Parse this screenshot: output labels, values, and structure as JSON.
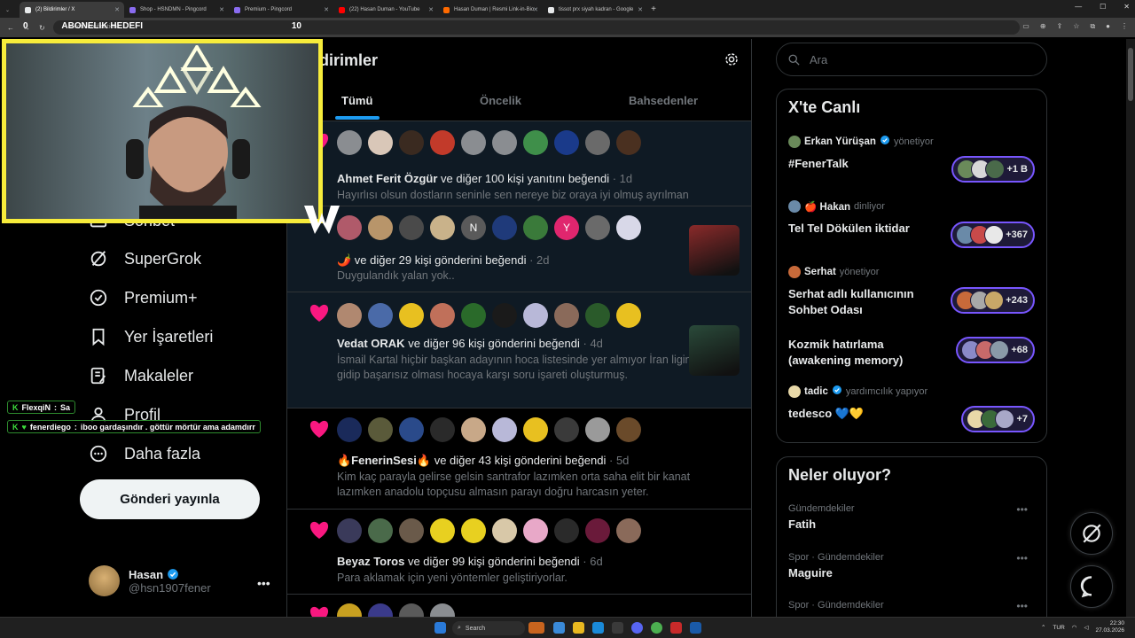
{
  "browser": {
    "tabs": [
      {
        "label": "(2) Bildirimler / X",
        "active": true,
        "color": "#e7e9ea"
      },
      {
        "label": "Shop - HSNDMN - Pingcord",
        "active": false,
        "color": "#8a6cf0"
      },
      {
        "label": "Premium - Pingcord",
        "active": false,
        "color": "#8a6cf0"
      },
      {
        "label": "(22) Hasan Duman - YouTube",
        "active": false,
        "color": "#ff0000"
      },
      {
        "label": "Hasan Duman | Resmi Link-in-Bio",
        "active": false,
        "color": "#ff6a00"
      },
      {
        "label": "tissot prx siyah kadran - Google",
        "active": false,
        "color": "#e7e9ea"
      }
    ],
    "url": "x.com/notifications"
  },
  "stream": {
    "goal_label": "ABONELIK HEDEFI",
    "goal_left": "0",
    "goal_right": "10"
  },
  "chat": [
    {
      "user": "FlexqiN",
      "message": "Sa"
    },
    {
      "user": "fenerdiego",
      "message": "iboo gardaşındır . göttür mörtür ama adamdırr"
    }
  ],
  "nav": {
    "items": [
      {
        "label": "Sohbet",
        "icon": "mail-icon"
      },
      {
        "label": "SuperGrok",
        "icon": "grok-icon"
      },
      {
        "label": "Premium+",
        "icon": "verified-icon"
      },
      {
        "label": "Yer İşaretleri",
        "icon": "bookmark-icon"
      },
      {
        "label": "Makaleler",
        "icon": "article-icon"
      },
      {
        "label": "Profil",
        "icon": "person-icon"
      },
      {
        "label": "Daha fazla",
        "icon": "more-circle-icon"
      }
    ],
    "post_button": "Gönderi yayınla",
    "profile_name": "Hasan",
    "profile_handle": "@hsn1907fener"
  },
  "main": {
    "title": "dirimler",
    "tabs": [
      "Tümü",
      "Öncelik",
      "Bahsedenler"
    ],
    "active_tab": "Tümü"
  },
  "notifications": [
    {
      "name": "Ahmet Ferit Özgür",
      "action": " ve diğer 100 kişi yanıtını beğendi",
      "time": " · 1d",
      "text": "Hayırlısı olsun dostların seninle sen nereye biz oraya iyi olmuş ayrılman",
      "avatars": [
        "#8a8d91",
        "#d9c7b8",
        "#3a2a20",
        "#c23a2a",
        "#8a8d91",
        "#8a8d91",
        "#3f8f4a",
        "#1a3a8a",
        "#6a6a6a",
        "#4a3020"
      ],
      "highlight": true
    },
    {
      "name": "🌶️",
      "action": " ve diğer 29 kişi gönderini beğendi",
      "time": " · 2d",
      "text": "Duygulandık yalan yok..",
      "avatars": [
        "#b05a6a",
        "#b8956a",
        "#4a4a4a",
        "#c9b28a",
        "#5a5a5a",
        "#1f3a7a",
        "#3a7a3a",
        "#e0266e",
        "#6a6a6a",
        "#d8d8e8"
      ],
      "letters": {
        "4": "N",
        "7": "Y"
      },
      "thumb": "#8a2a2a",
      "highlight": true
    },
    {
      "name": "Vedat ORAK",
      "action": " ve diğer 96 kişi gönderini beğendi",
      "time": " · 4d",
      "text": "İsmail Kartal hiçbir başkan adayının hoca listesinde yer almıyor İran ligine gidip başarısız olması hocaya karşı soru işareti oluşturmuş.",
      "avatars": [
        "#b08870",
        "#4a6aa8",
        "#e8c020",
        "#c0705a",
        "#2a6a2a",
        "#1a1a1a",
        "#b8b8d8",
        "#8a6a5a",
        "#2a5a2a",
        "#e8c020"
      ],
      "thumb": "#2a4a3a",
      "highlight": true
    },
    {
      "name": "🔥FenerinSesi🔥",
      "action": " ve diğer 43 kişi gönderini beğendi",
      "time": " · 5d",
      "text": "Kim kaç parayla gelirse gelsin santrafor lazımken orta saha elit bir kanat lazımken anadolu topçusu almasın parayı doğru harcasın yeter.",
      "avatars": [
        "#1a2a5a",
        "#5a5a3a",
        "#2a4a8a",
        "#2a2a2a",
        "#c8a888",
        "#b8b8d8",
        "#e8c020",
        "#3a3a3a",
        "#9a9a9a",
        "#6a4a2a"
      ],
      "highlight": false
    },
    {
      "name": "Beyaz Toros",
      "action": " ve diğer 99 kişi gönderini beğendi",
      "time": " · 6d",
      "text": "Para aklamak için yeni yöntemler geliştiriyorlar.",
      "avatars": [
        "#3a3a5a",
        "#4a6a4a",
        "#6a5a4a",
        "#e8d020",
        "#e8d020",
        "#d8c8a8",
        "#e8a8c8",
        "#2a2a2a",
        "#6a1a3a",
        "#8a6a5a"
      ],
      "highlight": false
    },
    {
      "name": "",
      "action": "",
      "time": "",
      "text": "",
      "avatars": [
        "#c8a020",
        "#3a3a8a",
        "#5a5a5a",
        "#8a8d91"
      ],
      "highlight": false
    }
  ],
  "right": {
    "search_placeholder": "Ara",
    "live_title": "X'te Canlı",
    "live": [
      {
        "host": "Erkan Yürüşan",
        "verified": true,
        "status": "yönetiyor",
        "title": "#FenerTalk",
        "count": "+1 B",
        "colors": [
          "#6a8a5a",
          "#d8d8d8",
          "#4a6a4a"
        ]
      },
      {
        "host": "🍎 Hakan",
        "verified": false,
        "status": "dinliyor",
        "title": "Tel Tel  Dökülen iktidar",
        "count": "+367",
        "colors": [
          "#6a8aa8",
          "#c84a4a",
          "#e8e8e8"
        ]
      },
      {
        "host": "Serhat",
        "verified": false,
        "status": "yönetiyor",
        "title": "Serhat adlı kullanıcının Sohbet Odası",
        "count": "+243",
        "colors": [
          "#c86a3a",
          "#a8a8a8",
          "#c8a868"
        ]
      },
      {
        "host": "",
        "verified": false,
        "status": "",
        "title": "Kozmik hatırlama (awakening memory)",
        "count": "+68",
        "colors": [
          "#8a8ac8",
          "#c86a6a",
          "#8a9aa8"
        ]
      },
      {
        "host": "tadic",
        "verified": true,
        "status": "yardımcılık yapıyor",
        "title": "tedesco 💙💛",
        "count": "+7",
        "colors": [
          "#e8d8a8",
          "#3a6a3a",
          "#a8a8c8"
        ]
      }
    ],
    "news_title": "Neler oluyor?",
    "trends": [
      {
        "category": "Gündemdekiler",
        "name": "Fatih"
      },
      {
        "category": "Spor · Gündemdekiler",
        "name": "Maguire"
      },
      {
        "category": "Spor · Gündemdekiler",
        "name": ""
      }
    ]
  },
  "taskbar": {
    "search": "Search",
    "lang": "TUR",
    "time": "22:30",
    "date": "27.03.2026"
  }
}
